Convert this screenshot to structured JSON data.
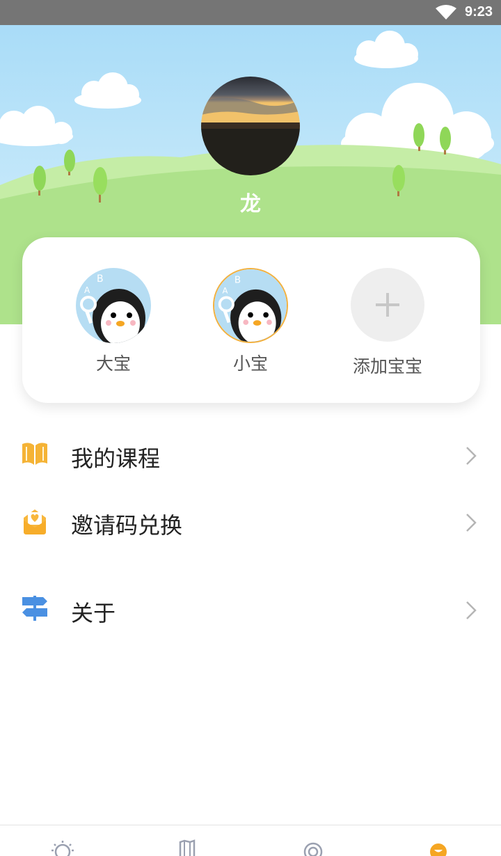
{
  "status_bar": {
    "time": "9:23",
    "wifi_icon": "wifi-icon"
  },
  "profile": {
    "name": "龙",
    "avatar_icon": "sunset-landscape-photo"
  },
  "kids": [
    {
      "name": "大宝",
      "avatar_icon": "penguin-avatar",
      "selected": false
    },
    {
      "name": "小宝",
      "avatar_icon": "penguin-avatar",
      "selected": true
    }
  ],
  "add_kid": {
    "label": "添加宝宝",
    "icon": "plus-icon"
  },
  "menu": [
    {
      "label": "我的课程",
      "icon": "book-icon",
      "icon_color": "#f5b335"
    },
    {
      "label": "邀请码兑换",
      "icon": "gift-heart-icon",
      "icon_color": "#f8b73d"
    },
    {
      "label": "关于",
      "icon": "signpost-icon",
      "icon_color": "#4a90e2"
    }
  ],
  "tabbar": [
    {
      "icon": "lightbulb-icon",
      "active": false
    },
    {
      "icon": "map-icon",
      "active": false
    },
    {
      "icon": "target-icon",
      "active": false
    },
    {
      "icon": "face-icon",
      "active": true
    }
  ],
  "colors": {
    "accent": "#f5a623",
    "sky": "#b6e1f7",
    "grass": "#aee28b",
    "tab_inactive": "#9aa0b0"
  }
}
